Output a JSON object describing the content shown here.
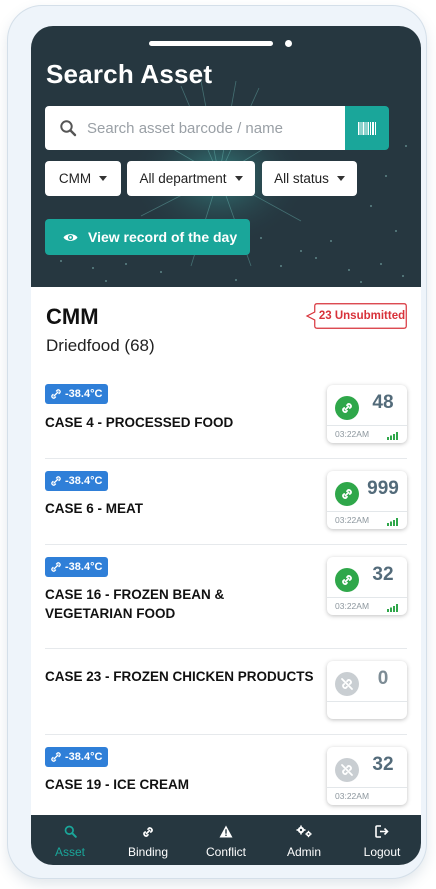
{
  "header": {
    "title": "Search Asset",
    "search_placeholder": "Search asset barcode / name",
    "filters": [
      "CMM",
      "All department",
      "All status"
    ],
    "view_button_label": "View record of the day"
  },
  "summary": {
    "site": "CMM",
    "department": "Driedfood (68)",
    "unsubmitted": "23 Unsubmitted"
  },
  "items": [
    {
      "temperature": "-38.4°C",
      "name": "CASE 4 - PROCESSED FOOD",
      "count": "48",
      "time": "03:22AM",
      "linked": true
    },
    {
      "temperature": "-38.4°C",
      "name": "CASE 6 - MEAT",
      "count": "999",
      "time": "03:22AM",
      "linked": true
    },
    {
      "temperature": "-38.4°C",
      "name": "CASE 16 - FROZEN BEAN & VEGETARIAN FOOD",
      "count": "32",
      "time": "03:22AM",
      "linked": true
    },
    {
      "temperature": "",
      "name": "CASE 23 - FROZEN CHICKEN PRODUCTS",
      "count": "0",
      "time": "",
      "linked": false
    },
    {
      "temperature": "-38.4°C",
      "name": "CASE 19 - ICE CREAM",
      "count": "32",
      "time": "03:22AM",
      "linked": false
    }
  ],
  "nav": [
    {
      "label": "Asset",
      "icon": "search-icon",
      "active": true
    },
    {
      "label": "Binding",
      "icon": "link-icon",
      "active": false
    },
    {
      "label": "Conflict",
      "icon": "warning-icon",
      "active": false
    },
    {
      "label": "Admin",
      "icon": "gears-icon",
      "active": false
    },
    {
      "label": "Logout",
      "icon": "logout-icon",
      "active": false
    }
  ],
  "colors": {
    "header_bg": "#263740",
    "accent": "#1aa69a",
    "badge_blue": "#2f7fd8",
    "linked_green": "#2fa74a",
    "unlinked_gray": "#c9ced2",
    "alert_red": "#d8323a"
  }
}
